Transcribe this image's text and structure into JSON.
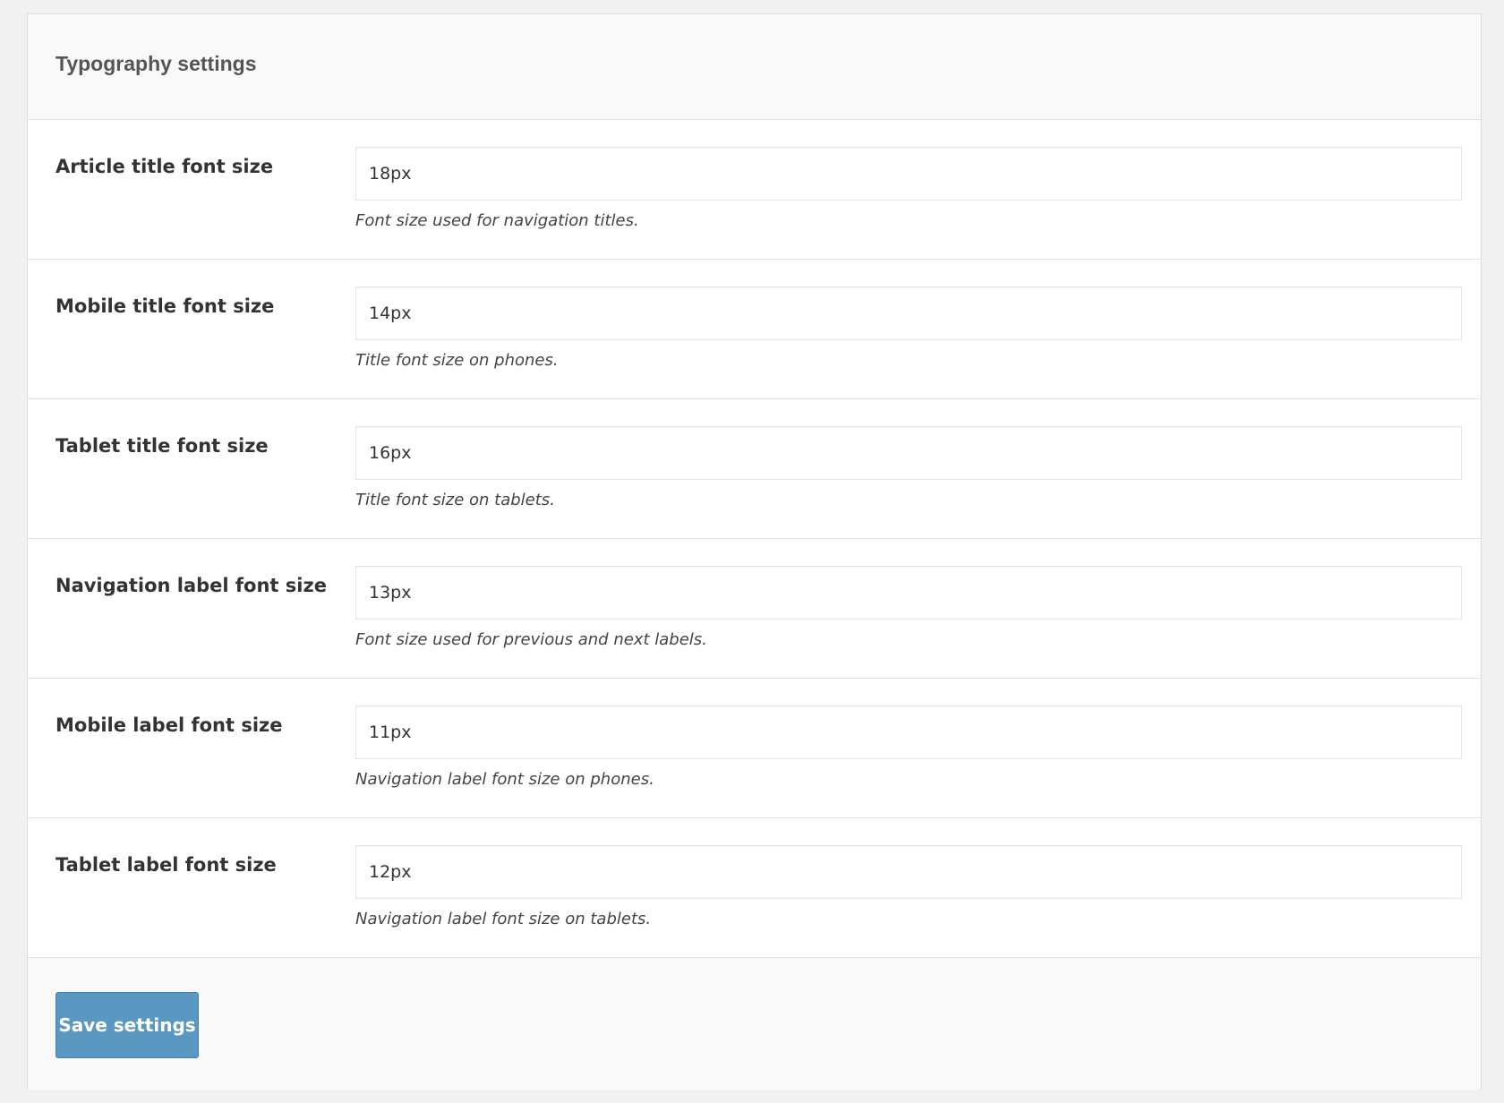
{
  "panel": {
    "title": "Typography settings"
  },
  "rows": [
    {
      "label": "Article title font size",
      "value": "18px",
      "help": "Font size used for navigation titles."
    },
    {
      "label": "Mobile title font size",
      "value": "14px",
      "help": "Title font size on phones."
    },
    {
      "label": "Tablet title font size",
      "value": "16px",
      "help": "Title font size on tablets."
    },
    {
      "label": "Navigation label font size",
      "value": "13px",
      "help": "Font size used for previous and next labels."
    },
    {
      "label": "Mobile label font size",
      "value": "11px",
      "help": "Navigation label font size on phones."
    },
    {
      "label": "Tablet label font size",
      "value": "12px",
      "help": "Navigation label font size on tablets."
    }
  ],
  "footer": {
    "save_label": "Save settings"
  },
  "colors": {
    "page_background": "#f1f1f1",
    "panel_background": "#ffffff",
    "header_background": "#f9f9f9",
    "button_background": "#5b98c1",
    "button_text": "#ffffff"
  }
}
